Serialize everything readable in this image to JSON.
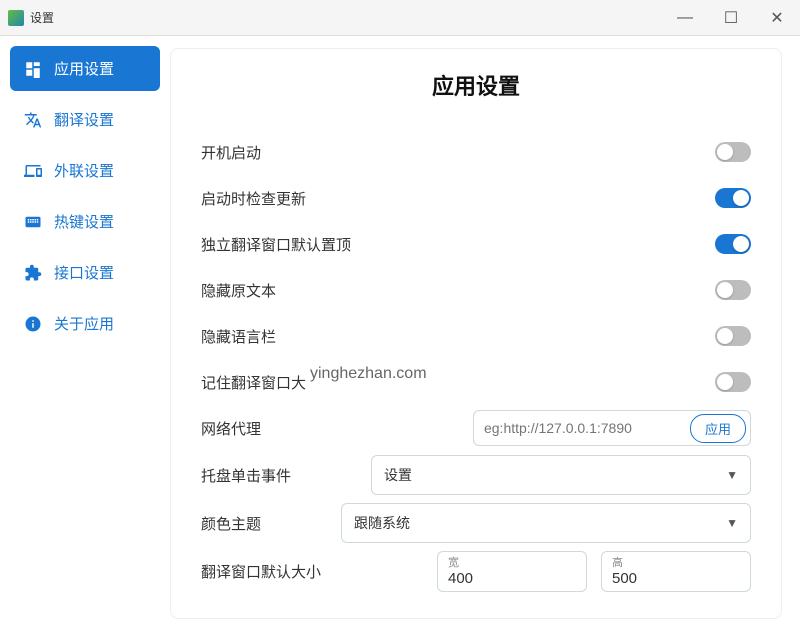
{
  "title": "设置",
  "sidebar": {
    "items": [
      {
        "label": "应用设置"
      },
      {
        "label": "翻译设置"
      },
      {
        "label": "外联设置"
      },
      {
        "label": "热键设置"
      },
      {
        "label": "接口设置"
      },
      {
        "label": "关于应用"
      }
    ]
  },
  "panel": {
    "heading": "应用设置",
    "startup_label": "开机启动",
    "check_update_label": "启动时检查更新",
    "pin_window_label": "独立翻译窗口默认置顶",
    "hide_source_label": "隐藏原文本",
    "hide_langbar_label": "隐藏语言栏",
    "remember_size_label": "记住翻译窗口大",
    "proxy_label": "网络代理",
    "proxy_placeholder": "eg:http://127.0.0.1:7890",
    "apply_btn": "应用",
    "tray_click_label": "托盘单击事件",
    "tray_click_value": "设置",
    "theme_label": "颜色主题",
    "theme_value": "跟随系统",
    "default_size_label": "翻译窗口默认大小",
    "width_caption": "宽",
    "height_caption": "高",
    "width_value": "400",
    "height_value": "500"
  },
  "toggles": {
    "startup": false,
    "check_update": true,
    "pin_window": true,
    "hide_source": false,
    "hide_langbar": false,
    "remember_size": false
  },
  "watermark": "yinghezhan.com"
}
